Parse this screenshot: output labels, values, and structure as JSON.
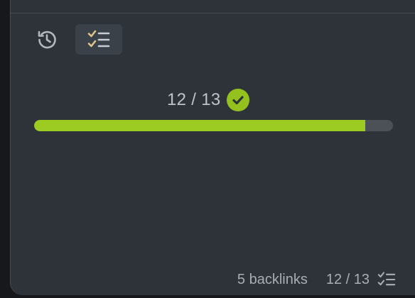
{
  "panel": {
    "tabs": [
      {
        "icon": "history-icon",
        "active": false
      },
      {
        "icon": "checklist-icon",
        "active": true
      }
    ]
  },
  "tasks": {
    "completed": 12,
    "total": 13,
    "progress_text": "12 / 13",
    "progress_fraction": 0.923,
    "status_icon": "check-circle-icon"
  },
  "status_bar": {
    "backlinks_text": "5 backlinks",
    "tasks_text": "12 / 13",
    "tasks_icon": "checklist-icon"
  },
  "colors": {
    "panel_bg": "#2d3339",
    "accent_green": "#9ccc22",
    "track": "#4b5157",
    "text": "#bfc3c7"
  }
}
